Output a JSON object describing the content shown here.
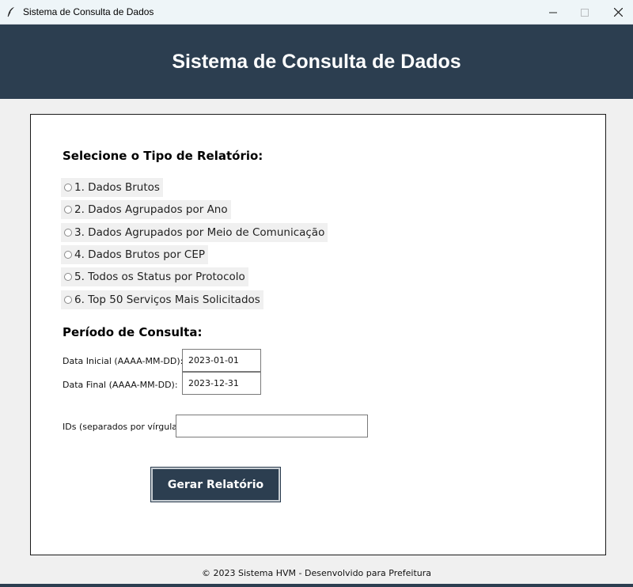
{
  "window": {
    "title": "Sistema de Consulta de Dados"
  },
  "header": {
    "title": "Sistema de Consulta de Dados"
  },
  "report_type": {
    "heading": "Selecione o Tipo de Relatório:",
    "options": [
      {
        "label": "1. Dados Brutos",
        "selected": false
      },
      {
        "label": "2. Dados Agrupados por Ano",
        "selected": false
      },
      {
        "label": "3. Dados Agrupados por Meio de Comunicação",
        "selected": false
      },
      {
        "label": "4. Dados Brutos por CEP",
        "selected": false
      },
      {
        "label": "5. Todos os Status por Protocolo",
        "selected": false
      },
      {
        "label": "6. Top 50 Serviços Mais Solicitados",
        "selected": false
      }
    ]
  },
  "period": {
    "heading": "Período de Consulta:",
    "start_label": "Data Inicial (AAAA-MM-DD):",
    "start_value": "2023-01-01",
    "end_label": "Data Final (AAAA-MM-DD):",
    "end_value": "2023-12-31"
  },
  "ids": {
    "label": "IDs (separados por vírgula):",
    "value": ""
  },
  "actions": {
    "generate_label": "Gerar Relatório"
  },
  "footer": {
    "text": "© 2023 Sistema HVM - Desenvolvido para Prefeitura"
  },
  "colors": {
    "header_bg": "#2c3e50",
    "button_bg": "#2c3e50",
    "window_bg": "#f0f0f0",
    "panel_bg": "#ffffff"
  }
}
